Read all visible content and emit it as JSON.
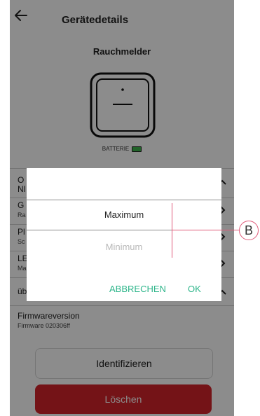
{
  "header": {
    "title": "Gerätedetails"
  },
  "device": {
    "name": "Rauchmelder",
    "battery_label": "BATTERIE",
    "battery_color": "#3cb44b"
  },
  "rows": [
    {
      "t1": "O",
      "t2": "Nl"
    },
    {
      "t1": "G",
      "t2": "Ra"
    },
    {
      "t1": "Pl",
      "t2": "Sc"
    },
    {
      "t1": "LE",
      "t2": "Ma"
    },
    {
      "t1": "üb",
      "t2": ""
    },
    {
      "t1": "Firmwareversion",
      "t2": "Firmware 020306ff"
    }
  ],
  "buttons": {
    "identify": "Identifizieren",
    "delete": "Löschen",
    "delete_color": "#d4242a"
  },
  "dialog": {
    "options": [
      "Maximum",
      "Minimum"
    ],
    "selected": "Maximum",
    "cancel": "ABBRECHEN",
    "ok": "OK",
    "accent": "#2db58a"
  },
  "callout": {
    "label": "B",
    "color": "#e05a7a"
  }
}
